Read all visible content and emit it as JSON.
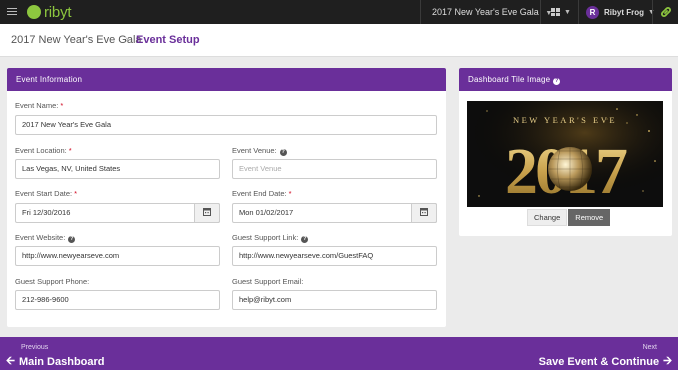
{
  "app": {
    "logo_text": "ribyt",
    "brand_color": "#8dc63f",
    "accent_color": "#6a2f9a"
  },
  "topbar": {
    "event_name": "2017 New Year's Eve Gala",
    "user_initial": "R",
    "user_name": "Ribyt Frog"
  },
  "breadcrumb": {
    "event": "2017 New Year's Eve Gala",
    "page": "Event Setup"
  },
  "event_info": {
    "title": "Event Information",
    "name_label": "Event Name:",
    "name_value": "2017 New Year's Eve Gala",
    "location_label": "Event Location:",
    "location_value": "Las Vegas, NV, United States",
    "venue_label": "Event Venue:",
    "venue_placeholder": "Event Venue",
    "start_label": "Event Start Date:",
    "start_value": "Fri 12/30/2016",
    "end_label": "Event End Date:",
    "end_value": "Mon 01/02/2017",
    "website_label": "Event Website:",
    "website_value": "http://www.newyearseve.com",
    "support_link_label": "Guest Support Link:",
    "support_link_value": "http://www.newyearseve.com/GuestFAQ",
    "support_phone_label": "Guest Support Phone:",
    "support_phone_value": "212-986-9600",
    "support_email_label": "Guest Support Email:",
    "support_email_value": "help@ribyt.com"
  },
  "tile": {
    "title": "Dashboard Tile Image",
    "image_caption": "NEW YEAR'S EVE",
    "image_year": "2017",
    "change_label": "Change",
    "remove_label": "Remove"
  },
  "footer": {
    "prev_small": "Previous",
    "prev_label": "Main Dashboard",
    "next_small": "Next",
    "next_label": "Save Event & Continue"
  }
}
